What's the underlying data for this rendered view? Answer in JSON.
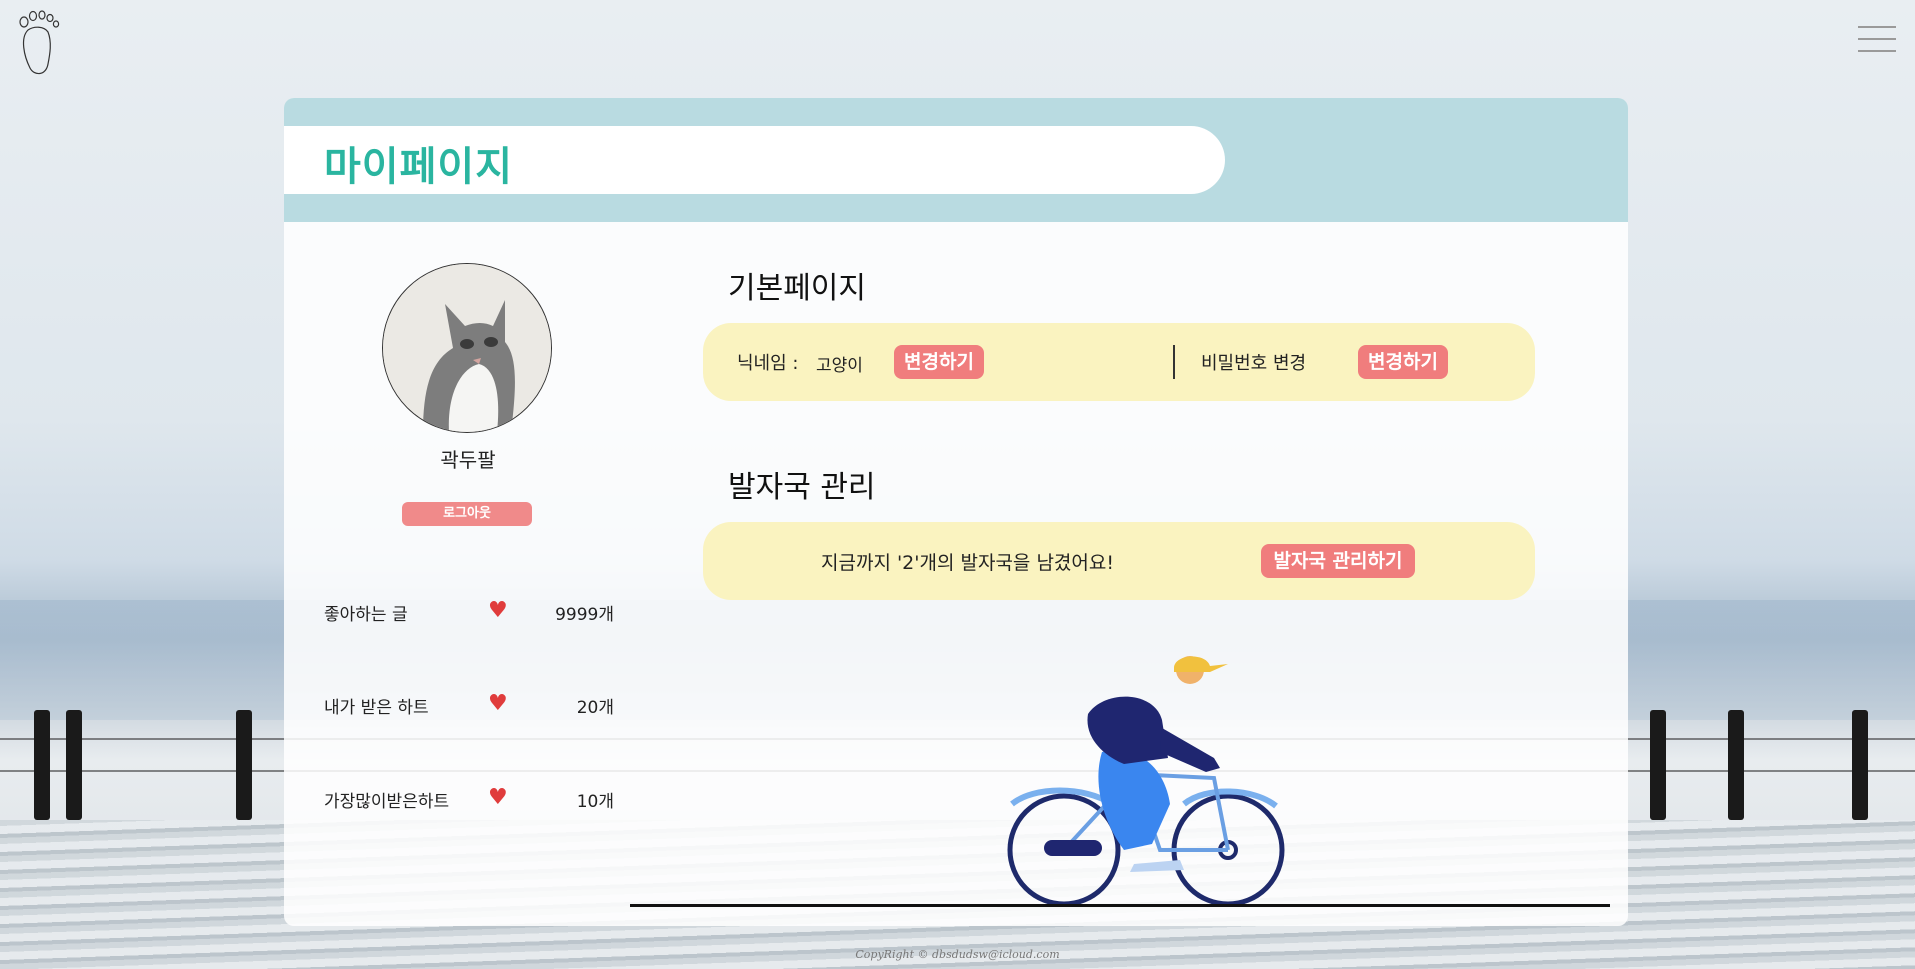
{
  "header": {
    "logo_icon": "footprint-icon",
    "menu_icon": "hamburger-menu-icon"
  },
  "page": {
    "title": "마이페이지"
  },
  "profile": {
    "avatar_icon": "cat-photo",
    "name": "곽두팔",
    "logout_label": "로그아웃"
  },
  "stats": [
    {
      "label": "좋아하는 글",
      "icon": "heart-icon",
      "value": "9999개"
    },
    {
      "label": "내가 받은 하트",
      "icon": "heart-icon",
      "value": "20개"
    },
    {
      "label": "가장많이받은하트",
      "icon": "heart-icon",
      "value": "10개"
    }
  ],
  "basic": {
    "section_title": "기본페이지",
    "nickname_label": "닉네임 :",
    "nickname_value": "고양이",
    "nickname_change_label": "변경하기",
    "password_label": "비밀번호 변경",
    "password_change_label": "변경하기"
  },
  "footprints": {
    "section_title": "발자국 관리",
    "message": "지금까지 '2'개의 발자국을 남겼어요!",
    "manage_label": "발자국 관리하기"
  },
  "footer": {
    "copyright": "CopyRight © dbsdudsw@icloud.com"
  },
  "colors": {
    "accent_teal": "#2ab5a0",
    "header_bg": "#b9dbe1",
    "pill_yellow": "#faf3c0",
    "button_pink": "#f07d7d",
    "heart": "#e03c3c"
  }
}
